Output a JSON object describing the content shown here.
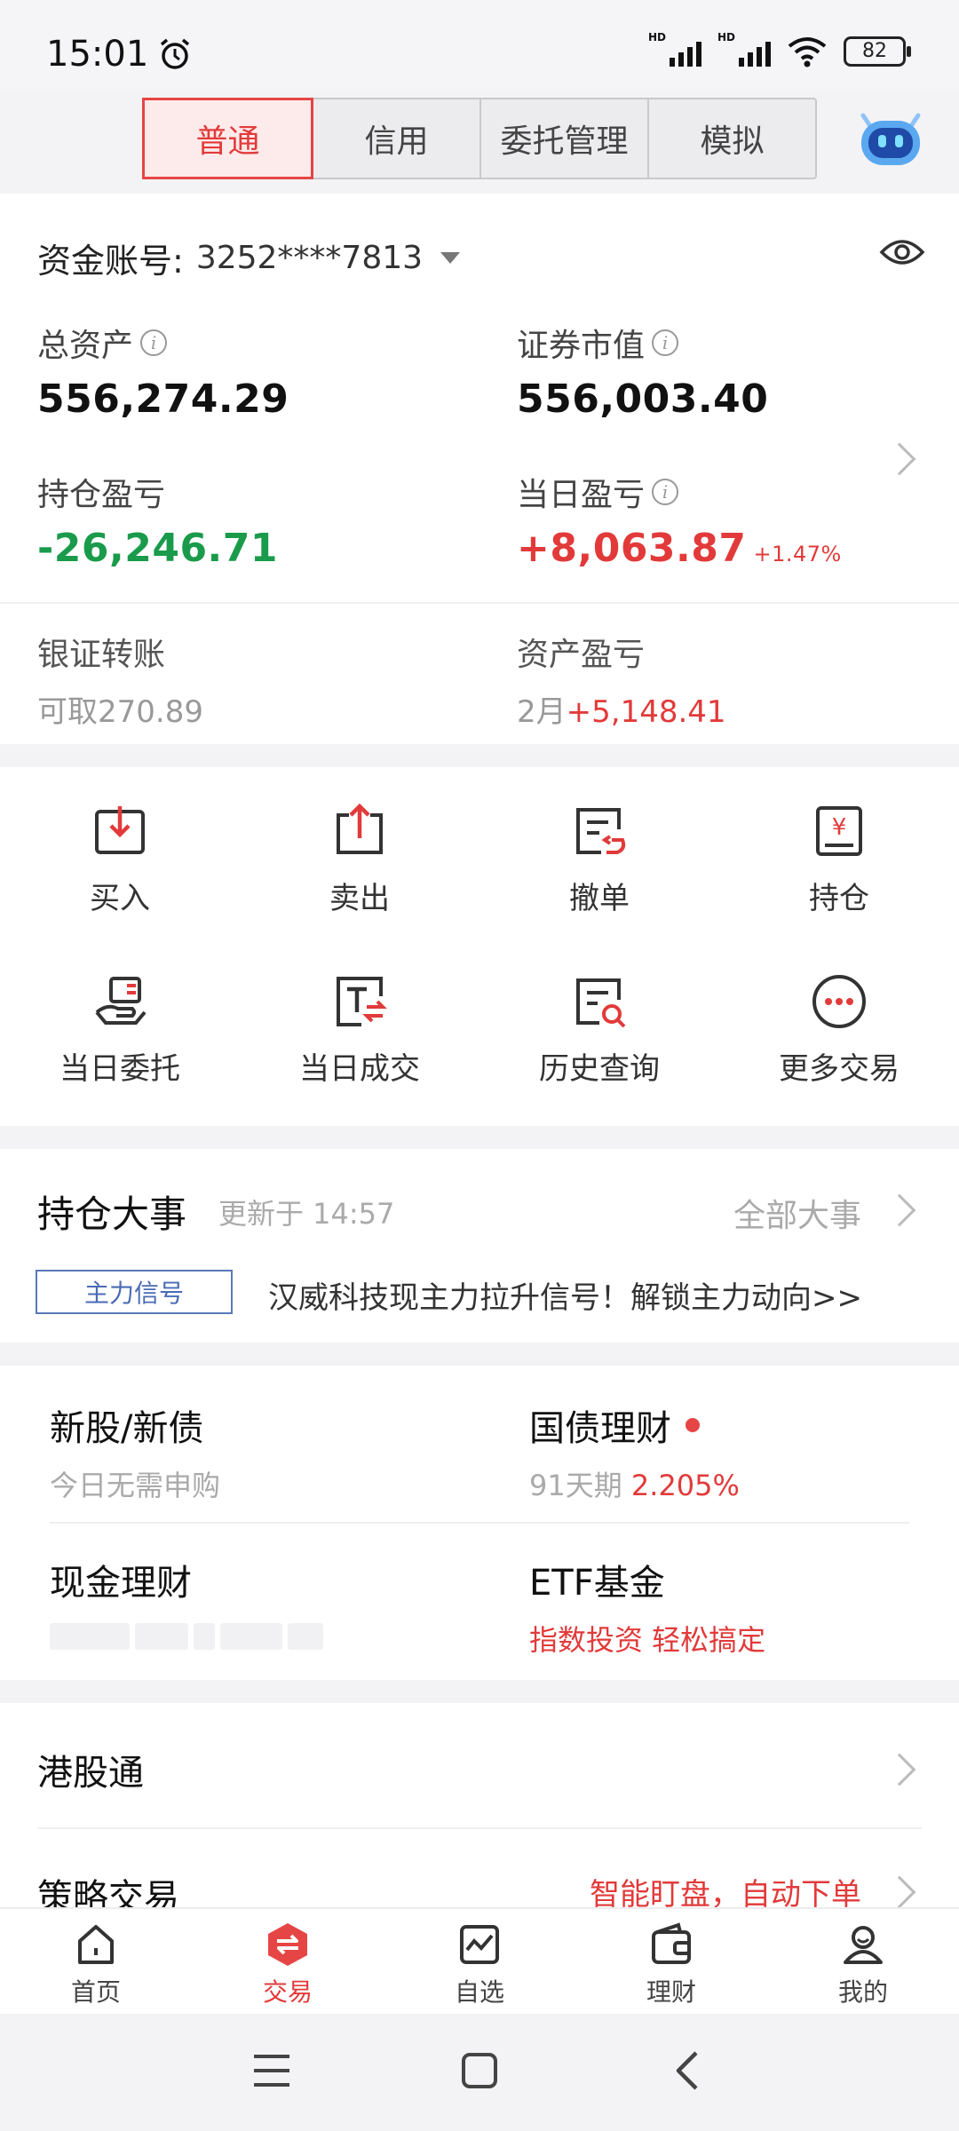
{
  "status": {
    "time": "15:01",
    "battery": "82"
  },
  "tabs": [
    "普通",
    "信用",
    "委托管理",
    "模拟"
  ],
  "account": {
    "label": "资金账号:",
    "number": "3252****7813",
    "total_assets_label": "总资产",
    "total_assets": "556,274.29",
    "market_value_label": "证券市值",
    "market_value": "556,003.40",
    "position_pl_label": "持仓盈亏",
    "position_pl": "-26,246.71",
    "today_pl_label": "当日盈亏",
    "today_pl": "+8,063.87",
    "today_pl_pct": "+1.47%",
    "bank_transfer_label": "银证转账",
    "bank_transfer_sub": "可取270.89",
    "asset_pl_label": "资产盈亏",
    "asset_pl_month": "2月",
    "asset_pl_value": "+5,148.41"
  },
  "actions": [
    {
      "label": "买入",
      "icon": "buy-icon"
    },
    {
      "label": "卖出",
      "icon": "sell-icon"
    },
    {
      "label": "撤单",
      "icon": "cancel-order-icon"
    },
    {
      "label": "持仓",
      "icon": "holdings-icon"
    },
    {
      "label": "当日委托",
      "icon": "today-order-icon"
    },
    {
      "label": "当日成交",
      "icon": "today-deal-icon"
    },
    {
      "label": "历史查询",
      "icon": "history-search-icon"
    },
    {
      "label": "更多交易",
      "icon": "more-icon"
    }
  ],
  "events": {
    "title": "持仓大事",
    "updated": "更新于 14:57",
    "all": "全部大事",
    "tag": "主力信号",
    "text": "汉威科技现主力拉升信号！解锁主力动向>>"
  },
  "products": {
    "ipo_title": "新股/新债",
    "ipo_sub": "今日无需申购",
    "bond_title": "国债理财",
    "bond_term": "91天期",
    "bond_rate": "2.205%",
    "cash_title": "现金理财",
    "etf_title": "ETF基金",
    "etf_sub": "指数投资 轻松搞定"
  },
  "lists": {
    "hk_title": "港股通",
    "strategy_title": "策略交易",
    "strategy_hint": "智能盯盘，自动下单"
  },
  "nav": [
    "首页",
    "交易",
    "自选",
    "理财",
    "我的"
  ],
  "colors": {
    "accent": "#e23a3a",
    "green": "#1a9b4b",
    "tag_blue": "#4a6bb5"
  }
}
